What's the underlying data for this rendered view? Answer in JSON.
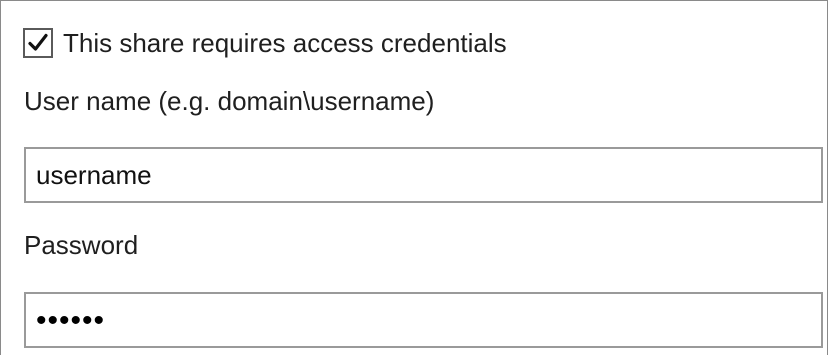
{
  "credentials_checkbox": {
    "checked": true,
    "label": "This share requires access credentials"
  },
  "username": {
    "label": "User name (e.g. domain\\username)",
    "value": "username"
  },
  "password": {
    "label": "Password",
    "masked_value": "••••••"
  }
}
